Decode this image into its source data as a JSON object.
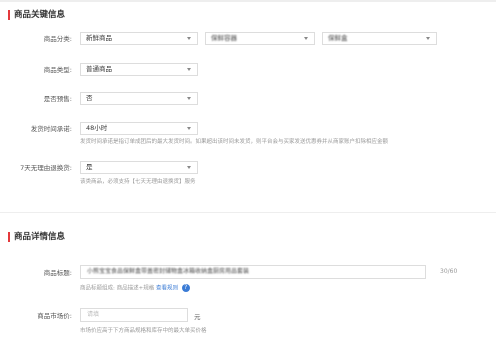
{
  "key_info": {
    "title": "商品关键信息",
    "category": {
      "label": "商品分类:",
      "level1": "新鲜商品",
      "level2": "保鲜容器",
      "level3": "保鲜盒"
    },
    "product_type": {
      "label": "商品类型:",
      "value": "普通商品"
    },
    "presale": {
      "label": "是否预售:",
      "value": "否"
    },
    "ship_time": {
      "label": "发货时间承诺:",
      "value": "48小时",
      "hint": "发货时间承诺是指订单成团后的最大发货时间。如果超出该时间未发货，则平台会与买家发送优惠券并从商家账户扣除相应金额"
    },
    "return_policy": {
      "label": "7天无理由退换货:",
      "value": "是",
      "hint": "该类商品，必须支持【七天无理由退换货】服务"
    }
  },
  "detail_info": {
    "title": "商品详情信息",
    "product_title": {
      "label": "商品标题:",
      "value": "小熊宝宝食品保鲜盒带盖密封储物盒冰箱收纳盒厨房用品套装",
      "counter": "30/60",
      "hint": "商品标题组成: 商品描述+规格",
      "hint_link": "查看规则",
      "help_icon": "?"
    },
    "market_price": {
      "label": "商品市场价:",
      "placeholder": "请填",
      "unit": "元",
      "hint": "市场价应高于下方商品规格和库存中的最大单买价格"
    }
  }
}
